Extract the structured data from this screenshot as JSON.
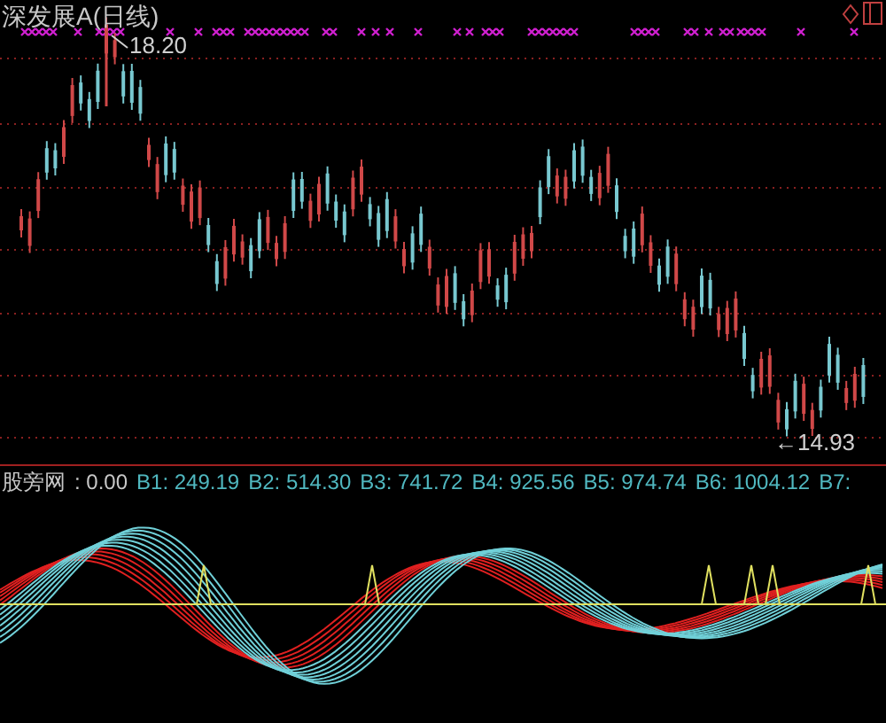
{
  "price_panel": {
    "title": "深发展A(日线)",
    "high_label": "18.20",
    "low_label": "←14.93"
  },
  "indicator_panel": {
    "name": "股旁网",
    "value": ": 0.00",
    "series": [
      {
        "label": "B1: 249.19"
      },
      {
        "label": "B2: 514.30"
      },
      {
        "label": "B3: 741.72"
      },
      {
        "label": "B4: 925.56"
      },
      {
        "label": "B5: 974.74"
      },
      {
        "label": "B6: 1004.12"
      },
      {
        "label": "B7:"
      }
    ]
  }
}
